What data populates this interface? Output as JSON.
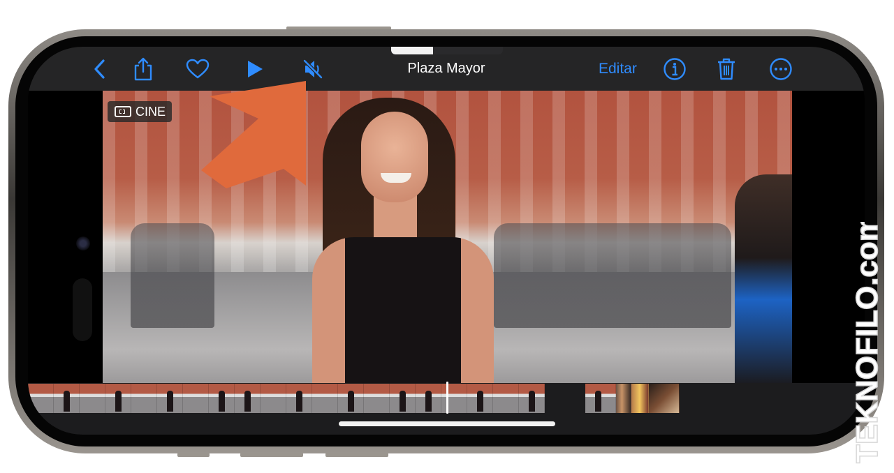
{
  "toolbar": {
    "title": "Plaza Mayor",
    "edit_label": "Editar",
    "accent_color": "#2f8cff",
    "icons": [
      "chevron-left-icon",
      "share-icon",
      "heart-icon",
      "play-icon",
      "speaker-muted-icon",
      "info-icon",
      "trash-icon",
      "more-icon"
    ]
  },
  "video": {
    "badge_label": "CINE",
    "annotation_color": "#e06a3c"
  },
  "watermark": {
    "text": "TEKNOFILO.com"
  }
}
